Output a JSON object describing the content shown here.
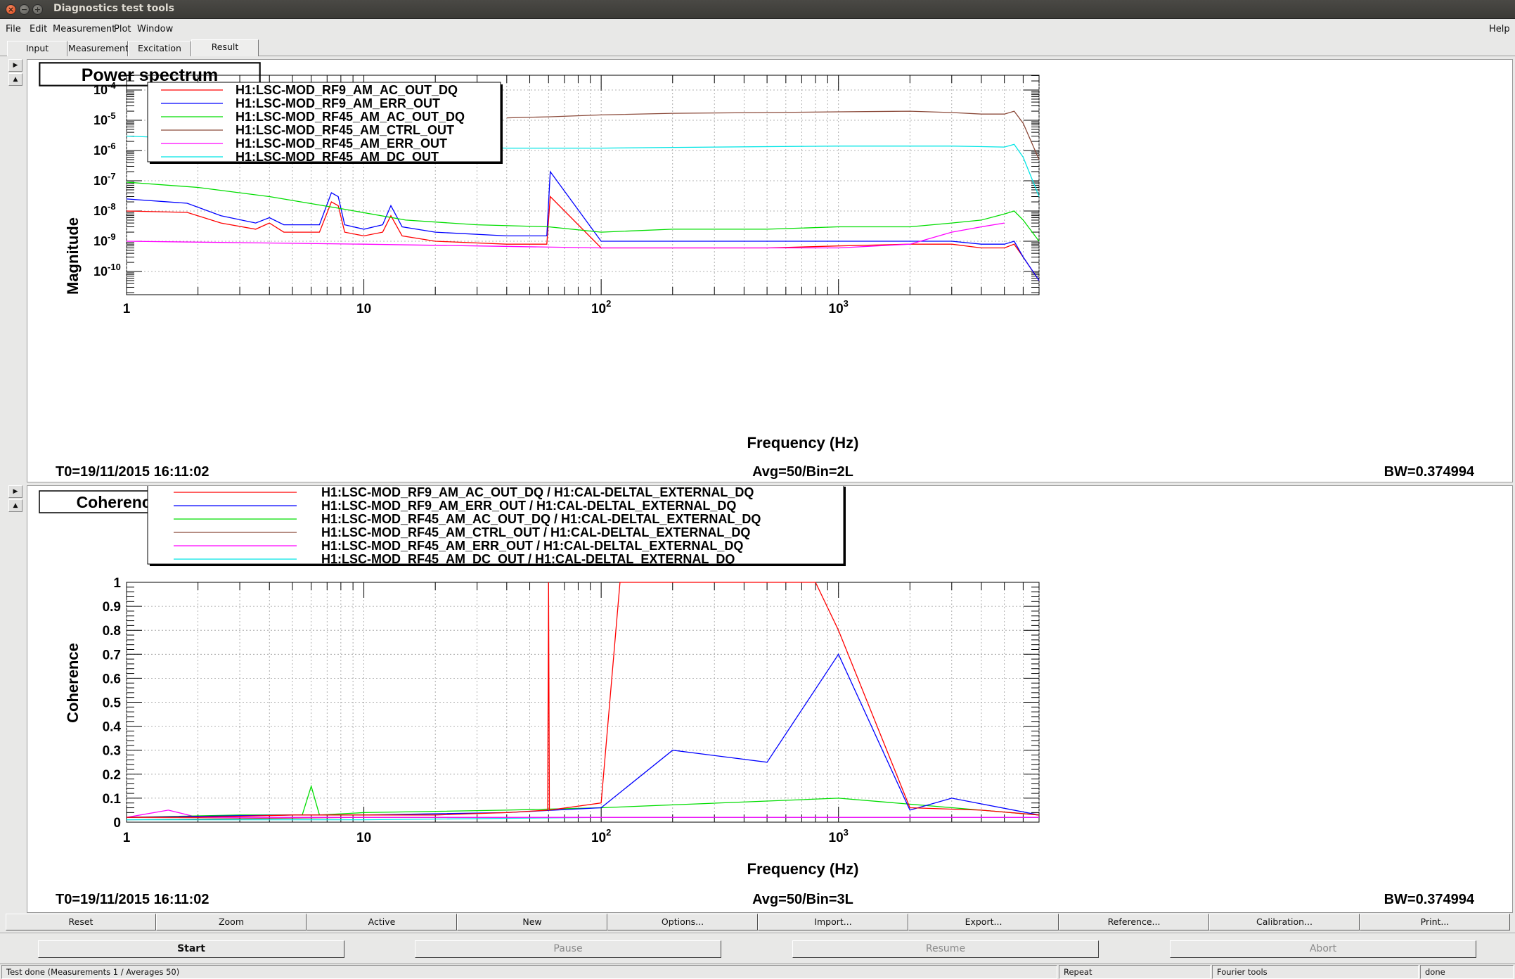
{
  "window": {
    "title": "Diagnostics test tools"
  },
  "menubar": {
    "items": [
      {
        "label": "File"
      },
      {
        "label": "Edit"
      },
      {
        "label": "Measurement"
      },
      {
        "label": "Plot"
      },
      {
        "label": "Window"
      }
    ],
    "help": "Help"
  },
  "tabs": [
    {
      "label": "Input"
    },
    {
      "label": "Measurement"
    },
    {
      "label": "Excitation"
    },
    {
      "label": "Result",
      "active": true
    }
  ],
  "icons": {
    "side_arrow_right": "triangle-right-icon",
    "side_arrow_up": "triangle-up-icon"
  },
  "power_plot": {
    "title": "Power spectrum",
    "xlabel": "Frequency (Hz)",
    "ylabel": "Magnitude",
    "t0": "T0=19/11/2015 16:11:02",
    "avg": "Avg=50/Bin=2L",
    "bw": "BW=0.374994",
    "yticks": [
      {
        "base": "10",
        "exp": "-4"
      },
      {
        "base": "10",
        "exp": "-5"
      },
      {
        "base": "10",
        "exp": "-6"
      },
      {
        "base": "10",
        "exp": "-7"
      },
      {
        "base": "10",
        "exp": "-8"
      },
      {
        "base": "10",
        "exp": "-9"
      },
      {
        "base": "10",
        "exp": "-10"
      }
    ],
    "xticks": [
      {
        "base": "1",
        "exp": ""
      },
      {
        "base": "10",
        "exp": ""
      },
      {
        "base": "10",
        "exp": "2"
      },
      {
        "base": "10",
        "exp": "3"
      }
    ],
    "legend": [
      {
        "label": "H1:LSC-MOD_RF9_AM_AC_OUT_DQ",
        "color": "#ff0000"
      },
      {
        "label": "H1:LSC-MOD_RF9_AM_ERR_OUT",
        "color": "#0000ff"
      },
      {
        "label": "H1:LSC-MOD_RF45_AM_AC_OUT_DQ",
        "color": "#00dd00"
      },
      {
        "label": "H1:LSC-MOD_RF45_AM_CTRL_OUT",
        "color": "#8b4a3a"
      },
      {
        "label": "H1:LSC-MOD_RF45_AM_ERR_OUT",
        "color": "#ff00ff"
      },
      {
        "label": "H1:LSC-MOD_RF45_AM_DC_OUT",
        "color": "#00e5e5"
      }
    ]
  },
  "coherence_plot": {
    "title": "Coherence",
    "xlabel": "Frequency (Hz)",
    "ylabel": "Coherence",
    "t0": "T0=19/11/2015 16:11:02",
    "avg": "Avg=50/Bin=3L",
    "bw": "BW=0.374994",
    "yticks": [
      "1",
      "0.9",
      "0.8",
      "0.7",
      "0.6",
      "0.5",
      "0.4",
      "0.3",
      "0.2",
      "0.1",
      "0"
    ],
    "xticks": [
      {
        "base": "1",
        "exp": ""
      },
      {
        "base": "10",
        "exp": ""
      },
      {
        "base": "10",
        "exp": "2"
      },
      {
        "base": "10",
        "exp": "3"
      }
    ],
    "legend": [
      {
        "label": "H1:LSC-MOD_RF9_AM_AC_OUT_DQ / H1:CAL-DELTAL_EXTERNAL_DQ",
        "color": "#ff0000"
      },
      {
        "label": "H1:LSC-MOD_RF9_AM_ERR_OUT / H1:CAL-DELTAL_EXTERNAL_DQ",
        "color": "#0000ff"
      },
      {
        "label": "H1:LSC-MOD_RF45_AM_AC_OUT_DQ / H1:CAL-DELTAL_EXTERNAL_DQ",
        "color": "#00dd00"
      },
      {
        "label": "H1:LSC-MOD_RF45_AM_CTRL_OUT / H1:CAL-DELTAL_EXTERNAL_DQ",
        "color": "#8b4a3a"
      },
      {
        "label": "H1:LSC-MOD_RF45_AM_ERR_OUT / H1:CAL-DELTAL_EXTERNAL_DQ",
        "color": "#ff00ff"
      },
      {
        "label": "H1:LSC-MOD_RF45_AM_DC_OUT / H1:CAL-DELTAL_EXTERNAL_DQ",
        "color": "#00e5e5"
      }
    ]
  },
  "chart_data": [
    {
      "type": "line",
      "title": "Power spectrum",
      "xlabel": "Frequency (Hz)",
      "ylabel": "Magnitude",
      "xscale": "log",
      "yscale": "log",
      "xlim": [
        1,
        7000
      ],
      "ylim": [
        5e-11,
        0.0002
      ],
      "grid": true,
      "legend_position": "top-left",
      "series": [
        {
          "name": "H1:LSC-MOD_RF9_AM_AC_OUT_DQ",
          "color": "#ff0000",
          "x": [
            1,
            1.8,
            2.5,
            3.5,
            4,
            4.6,
            6.5,
            7.3,
            7.8,
            8.3,
            10,
            12,
            13,
            14.5,
            20,
            40,
            59,
            61,
            100,
            200,
            500,
            1000,
            2000,
            3000,
            4000,
            5000,
            5500,
            6000,
            7000
          ],
          "y": [
            1e-08,
            9e-09,
            4e-09,
            2.5e-09,
            4e-09,
            2e-09,
            2e-09,
            2e-08,
            1.5e-08,
            2e-09,
            1.5e-09,
            2e-09,
            7e-09,
            1.5e-09,
            1e-09,
            8e-10,
            8e-10,
            3e-08,
            6e-10,
            6e-10,
            6e-10,
            7e-10,
            8e-10,
            8e-10,
            6e-10,
            6e-10,
            8e-10,
            3e-10,
            5e-11
          ]
        },
        {
          "name": "H1:LSC-MOD_RF9_AM_ERR_OUT",
          "color": "#0000ff",
          "x": [
            1,
            1.8,
            2.5,
            3.5,
            4,
            4.6,
            6.5,
            7.3,
            7.8,
            8.3,
            10,
            12,
            13,
            14.5,
            20,
            40,
            59,
            61,
            100,
            200,
            500,
            1000,
            2000,
            3000,
            4000,
            5000,
            5500,
            6000,
            7000
          ],
          "y": [
            2.5e-08,
            1.8e-08,
            7e-09,
            4e-09,
            6e-09,
            3.5e-09,
            3.5e-09,
            4e-08,
            3e-08,
            3.5e-09,
            2.5e-09,
            3.5e-09,
            1.5e-08,
            3e-09,
            2e-09,
            1.5e-09,
            1.5e-09,
            2e-07,
            1e-09,
            1e-09,
            1e-09,
            1e-09,
            1e-09,
            1e-09,
            8e-10,
            8e-10,
            1e-09,
            3e-10,
            5e-11
          ]
        },
        {
          "name": "H1:LSC-MOD_RF45_AM_AC_OUT_DQ",
          "color": "#00dd00",
          "x": [
            1,
            2,
            4,
            8,
            15,
            30,
            60,
            100,
            200,
            500,
            1000,
            2000,
            3000,
            4000,
            5000,
            5500,
            6000,
            7000
          ],
          "y": [
            9e-08,
            6e-08,
            3e-08,
            1.2e-08,
            5e-09,
            3.5e-09,
            3e-09,
            2e-09,
            2.5e-09,
            2.5e-09,
            3e-09,
            3e-09,
            4e-09,
            5e-09,
            8e-09,
            1e-08,
            5e-09,
            1e-09
          ]
        },
        {
          "name": "H1:LSC-MOD_RF45_AM_CTRL_OUT",
          "color": "#8b4a3a",
          "x": [
            40,
            60,
            100,
            200,
            500,
            1000,
            2000,
            3000,
            4000,
            5000,
            5500,
            6000,
            7000
          ],
          "y": [
            1.2e-05,
            1.3e-05,
            1.5e-05,
            1.7e-05,
            1.8e-05,
            1.9e-05,
            2e-05,
            1.8e-05,
            1.6e-05,
            1.6e-05,
            2e-05,
            8e-06,
            5e-07
          ]
        },
        {
          "name": "H1:LSC-MOD_RF45_AM_ERR_OUT",
          "color": "#ff00ff",
          "x": [
            1,
            3,
            10,
            30,
            100,
            300,
            1000,
            2000,
            3000,
            4000,
            5000
          ],
          "y": [
            1e-09,
            9e-10,
            8e-10,
            7e-10,
            6e-10,
            6e-10,
            6e-10,
            8e-10,
            2e-09,
            3e-09,
            4e-09
          ]
        },
        {
          "name": "H1:LSC-MOD_RF45_AM_DC_OUT",
          "color": "#00e5e5",
          "x": [
            1,
            10,
            40,
            100,
            300,
            1000,
            3000,
            5000,
            5500,
            6000,
            7000
          ],
          "y": [
            3e-06,
            1.5e-06,
            1.2e-06,
            1.2e-06,
            1.3e-06,
            1.4e-06,
            1.4e-06,
            1.3e-06,
            1.6e-06,
            6e-07,
            3e-08
          ]
        }
      ]
    },
    {
      "type": "line",
      "title": "Coherence",
      "xlabel": "Frequency (Hz)",
      "ylabel": "Coherence",
      "xscale": "log",
      "xlim": [
        1,
        7000
      ],
      "ylim": [
        0,
        1
      ],
      "grid": true,
      "legend_position": "top-left",
      "series": [
        {
          "name": "H1:LSC-MOD_RF9_AM_AC_OUT_DQ / H1:CAL-DELTAL_EXTERNAL_DQ",
          "color": "#ff0000",
          "x": [
            1,
            2,
            5,
            10,
            20,
            40,
            59.5,
            60,
            60.5,
            100,
            120,
            150,
            180,
            200,
            300,
            400,
            500,
            600,
            800,
            1000,
            2000,
            4000,
            7000
          ],
          "y": [
            0.02,
            0.02,
            0.03,
            0.03,
            0.03,
            0.04,
            0.05,
            1.0,
            0.05,
            0.08,
            1.0,
            1.0,
            1.0,
            1.0,
            1.0,
            1.0,
            1.0,
            1.0,
            1.0,
            0.8,
            0.06,
            0.05,
            0.03
          ]
        },
        {
          "name": "H1:LSC-MOD_RF9_AM_ERR_OUT / H1:CAL-DELTAL_EXTERNAL_DQ",
          "color": "#0000ff",
          "x": [
            1,
            5,
            10,
            40,
            100,
            200,
            500,
            1000,
            2000,
            3000,
            7000
          ],
          "y": [
            0.02,
            0.03,
            0.03,
            0.04,
            0.06,
            0.3,
            0.25,
            0.7,
            0.05,
            0.1,
            0.03
          ]
        },
        {
          "name": "H1:LSC-MOD_RF45_AM_AC_OUT_DQ / H1:CAL-DELTAL_EXTERNAL_DQ",
          "color": "#00dd00",
          "x": [
            1,
            3,
            5.5,
            6,
            6.5,
            10,
            40,
            100,
            1000,
            7000
          ],
          "y": [
            0.02,
            0.03,
            0.03,
            0.15,
            0.03,
            0.04,
            0.05,
            0.06,
            0.1,
            0.03
          ]
        },
        {
          "name": "H1:LSC-MOD_RF45_AM_CTRL_OUT / H1:CAL-DELTAL_EXTERNAL_DQ",
          "color": "#8b4a3a",
          "x": [
            1,
            10,
            100,
            1000,
            7000
          ],
          "y": [
            0.01,
            0.02,
            0.02,
            0.02,
            0.02
          ]
        },
        {
          "name": "H1:LSC-MOD_RF45_AM_ERR_OUT / H1:CAL-DELTAL_EXTERNAL_DQ",
          "color": "#ff00ff",
          "x": [
            1,
            1.5,
            2,
            10,
            100,
            1000,
            7000
          ],
          "y": [
            0.02,
            0.05,
            0.02,
            0.02,
            0.02,
            0.02,
            0.02
          ]
        },
        {
          "name": "H1:LSC-MOD_RF45_AM_DC_OUT / H1:CAL-DELTAL_EXTERNAL_DQ",
          "color": "#00e5e5",
          "x": [
            1,
            10,
            100,
            1000,
            7000
          ],
          "y": [
            0.01,
            0.01,
            0.02,
            0.02,
            0.02
          ]
        }
      ]
    }
  ],
  "toolbar": {
    "buttons": [
      {
        "label": "Reset"
      },
      {
        "label": "Zoom"
      },
      {
        "label": "Active"
      },
      {
        "label": "New"
      },
      {
        "label": "Options..."
      },
      {
        "label": "Import..."
      },
      {
        "label": "Export..."
      },
      {
        "label": "Reference..."
      },
      {
        "label": "Calibration..."
      },
      {
        "label": "Print..."
      }
    ]
  },
  "controls": {
    "start": "Start",
    "pause": "Pause",
    "resume": "Resume",
    "abort": "Abort"
  },
  "status": {
    "message": "Test done (Measurements 1 / Averages 50)",
    "repeat": "Repeat",
    "tool": "Fourier tools",
    "state": "done"
  }
}
